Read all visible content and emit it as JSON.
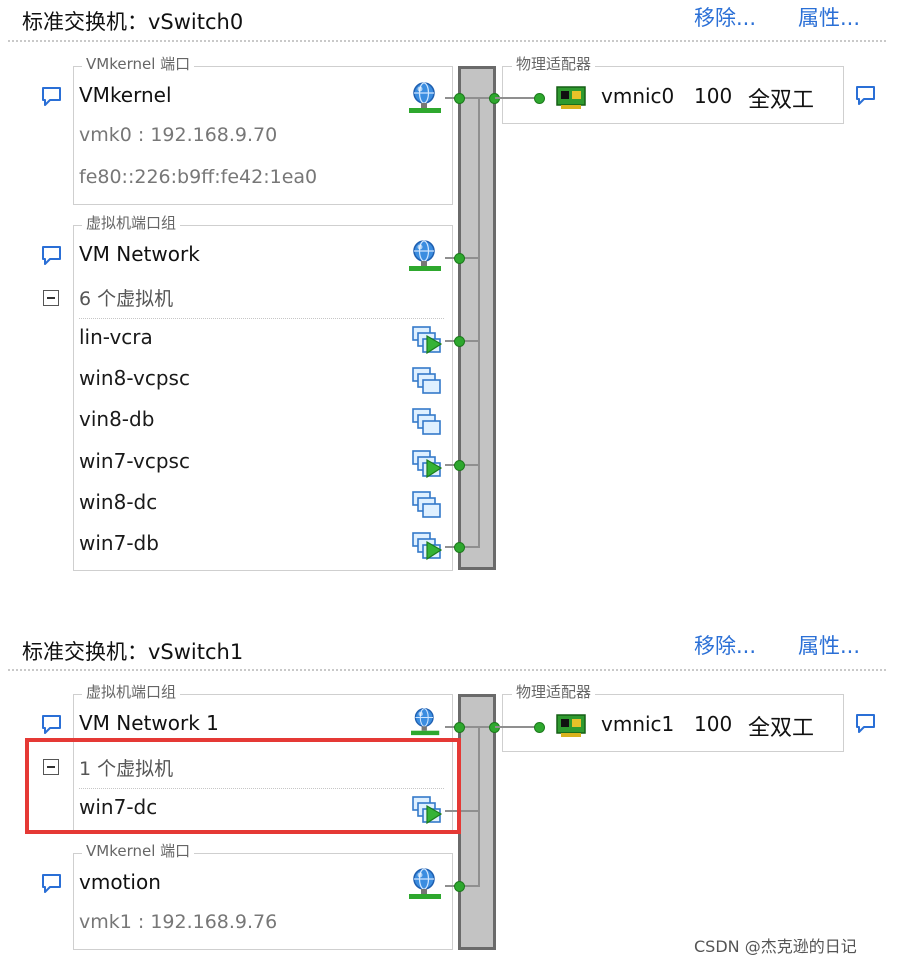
{
  "switch0": {
    "title": "标准交换机：vSwitch0",
    "remove_label": "移除...",
    "properties_label": "属性...",
    "vmkernel_group": {
      "legend": "VMkernel 端口",
      "name": "VMkernel",
      "ip": "vmk0 : 192.168.9.70",
      "ipv6": "fe80::226:b9ff:fe42:1ea0"
    },
    "vm_group": {
      "legend": "虚拟机端口组",
      "name": "VM Network",
      "vm_count": "6 个虚拟机",
      "vms": [
        "lin-vcra",
        "win8-vcpsc",
        "vin8-db",
        "win7-vcpsc",
        "win8-dc",
        "win7-db"
      ]
    },
    "adapter": {
      "legend": "物理适配器",
      "nic": "vmnic0",
      "speed": "100",
      "duplex": "全双工"
    }
  },
  "switch1": {
    "title": "标准交换机：vSwitch1",
    "remove_label": "移除...",
    "properties_label": "属性...",
    "vm_group": {
      "legend": "虚拟机端口组",
      "name": "VM Network 1",
      "vm_count": "1 个虚拟机",
      "vms": [
        "win7-dc"
      ]
    },
    "vmkernel_group": {
      "legend": "VMkernel 端口",
      "name": "vmotion",
      "ip": "vmk1 : 192.168.9.76"
    },
    "adapter": {
      "legend": "物理适配器",
      "nic": "vmnic1",
      "speed": "100",
      "duplex": "全双工"
    }
  },
  "colors": {
    "link": "#2a6fd6",
    "highlight": "#e53935",
    "port": "#2ea82e",
    "switch_bar": "#c3c3c3"
  },
  "icons": {
    "callout": "speech-bubble-icon",
    "network": "globe-network-icon",
    "vm": "virtual-machine-icon",
    "nic": "network-card-icon"
  },
  "watermark": "CSDN @杰克逊的日记"
}
